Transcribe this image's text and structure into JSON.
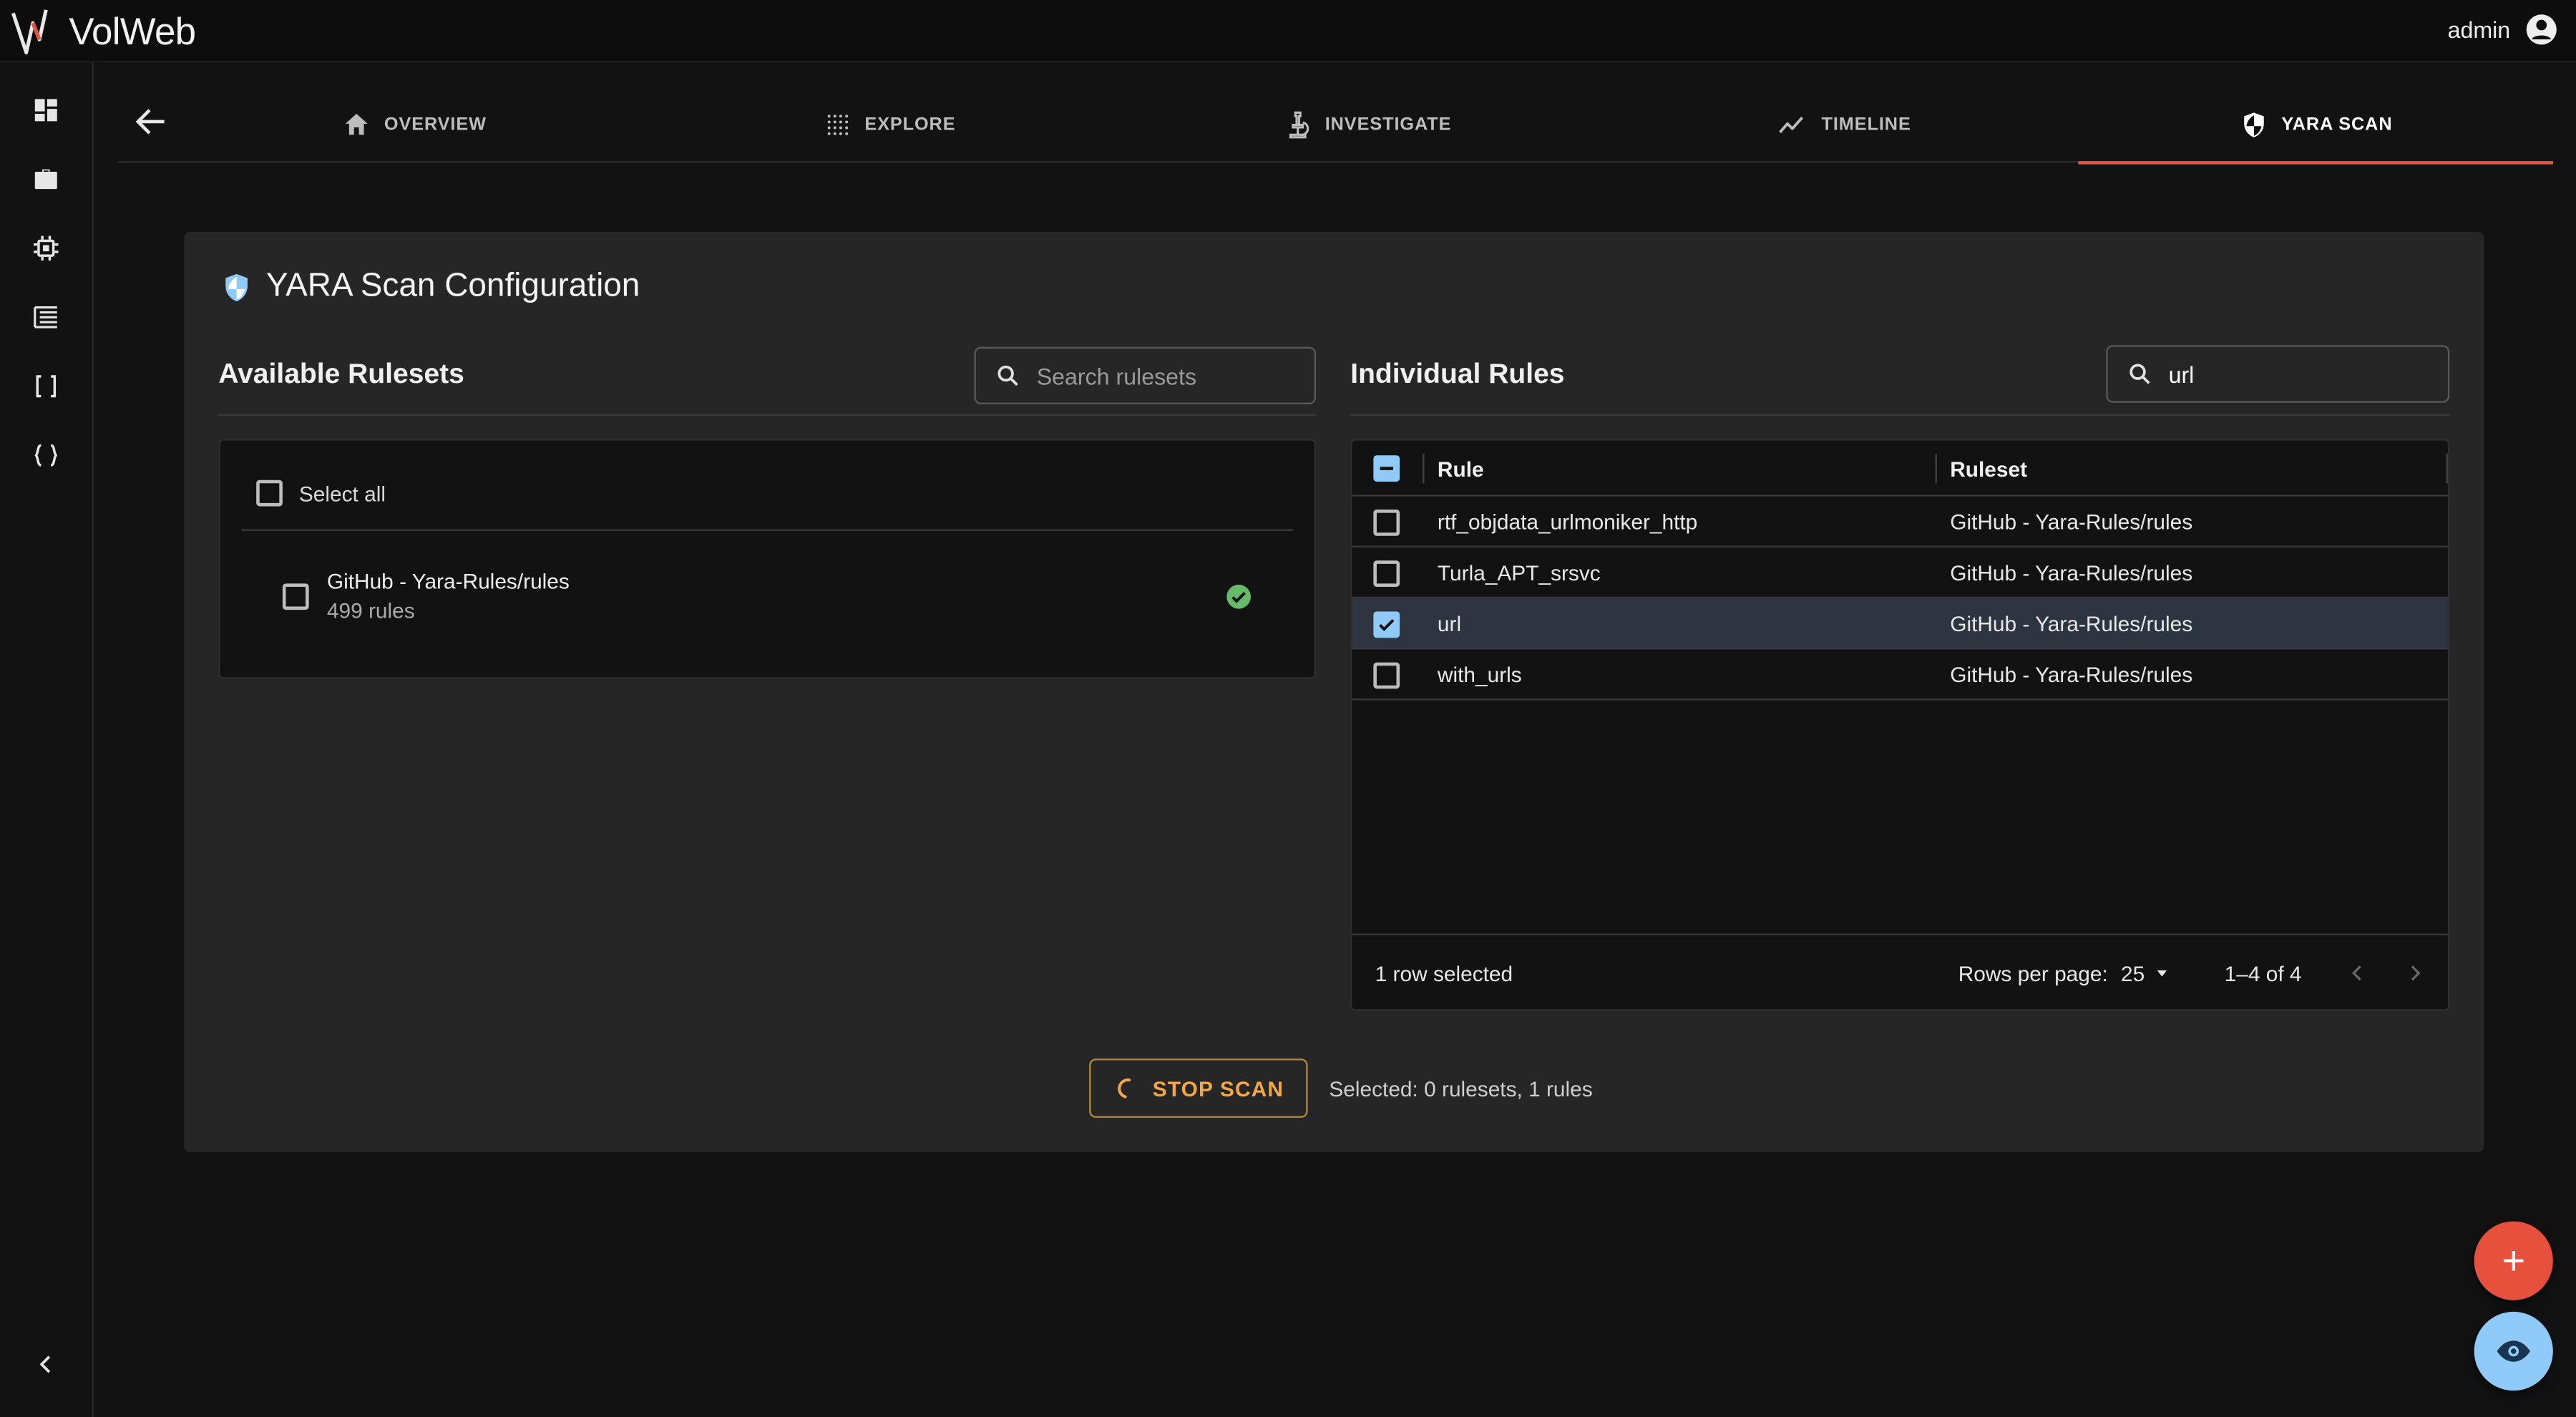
{
  "app": {
    "name": "VolWeb",
    "user": "admin"
  },
  "sidebar": {
    "items": [
      {
        "icon": "dashboard-icon"
      },
      {
        "icon": "briefcase-icon"
      },
      {
        "icon": "chip-icon"
      },
      {
        "icon": "table-icon"
      },
      {
        "icon": "brackets-icon"
      },
      {
        "icon": "braces-icon"
      }
    ],
    "collapse_icon": "chevron-left-icon"
  },
  "tabs": [
    {
      "label": "OVERVIEW",
      "icon": "home-icon",
      "active": false
    },
    {
      "label": "EXPLORE",
      "icon": "grid-dots-icon",
      "active": false
    },
    {
      "label": "INVESTIGATE",
      "icon": "microscope-icon",
      "active": false
    },
    {
      "label": "TIMELINE",
      "icon": "timeline-icon",
      "active": false
    },
    {
      "label": "YARA SCAN",
      "icon": "shield-icon",
      "active": true
    }
  ],
  "card": {
    "title": "YARA Scan Configuration"
  },
  "rulesets": {
    "title": "Available Rulesets",
    "search_placeholder": "Search rulesets",
    "select_all_label": "Select all",
    "items": [
      {
        "name": "GitHub - Yara-Rules/rules",
        "count": "499 rules",
        "status": "ready"
      }
    ]
  },
  "rules": {
    "title": "Individual Rules",
    "search_value": "url",
    "columns": {
      "rule": "Rule",
      "ruleset": "Ruleset"
    },
    "rows": [
      {
        "rule": "rtf_objdata_urlmoniker_http",
        "ruleset": "GitHub - Yara-Rules/rules",
        "selected": false
      },
      {
        "rule": "Turla_APT_srsvc",
        "ruleset": "GitHub - Yara-Rules/rules",
        "selected": false
      },
      {
        "rule": "url",
        "ruleset": "GitHub - Yara-Rules/rules",
        "selected": true
      },
      {
        "rule": "with_urls",
        "ruleset": "GitHub - Yara-Rules/rules",
        "selected": false
      }
    ],
    "footer": {
      "selected_text": "1 row selected",
      "rows_per_page_label": "Rows per page:",
      "rows_per_page_value": "25",
      "range": "1–4 of 4"
    }
  },
  "actions": {
    "stop_label": "STOP SCAN",
    "summary": "Selected: 0 rulesets, 1 rules"
  },
  "colors": {
    "accent": "#e8533f",
    "primary": "#90caf9",
    "warning": "#f4a742",
    "success": "#66bb6a"
  }
}
